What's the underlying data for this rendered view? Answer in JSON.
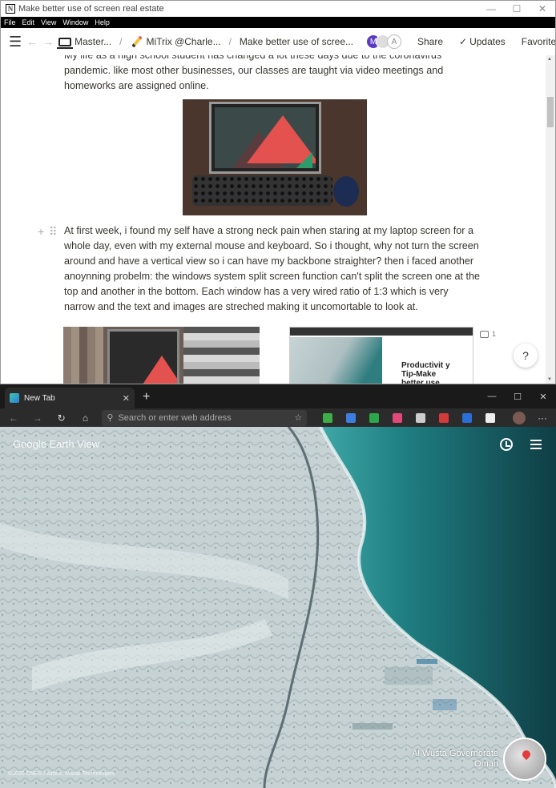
{
  "notion": {
    "window_title": "Make better use of screen real estate",
    "app_icon_letter": "N",
    "menu": [
      "File",
      "Edit",
      "View",
      "Window",
      "Help"
    ],
    "breadcrumbs": [
      "Master...",
      "MiTrix @Charle...",
      "Make better use of scree..."
    ],
    "avatar_initials": [
      "M",
      "A"
    ],
    "actions": {
      "share": "Share",
      "updates": "Updates",
      "favorite": "Favorite",
      "more": "•••"
    },
    "paragraph_1": "My life as a high school student has changed a lot these days due to the coronavirus pandemic. like most other businesses, our classes are taught via video meetings and homeworks are assigned online.",
    "paragraph_2": "At first week, i found my self have a strong neck pain when staring at my laptop screen for a whole day, even with my external mouse and keyboard. So i thought, why not turn the screen around and have a vertical view so i can have my backbone straighter? then i faced another anoynning probelm: the windows system split screen function can't split the screen one at the top and another in the bottom. Each window has a very wired ratio of 1:3 which is very narrow and the text and images are streched making it uncomortable to look at.",
    "embedded_screenshot_heading": "Productivit y Tip-Make better use",
    "comment_count": "1",
    "help_label": "?"
  },
  "edge": {
    "tab_title": "New Tab",
    "new_tab_symbol": "+",
    "address_placeholder": "Search or enter web address",
    "more_label": "···",
    "extension_colors": [
      "#3fae49",
      "#3d7fe0",
      "#2aa84a",
      "#e04a7a",
      "#cccccc",
      "#d33b3b",
      "#2b6fd6",
      "#eeeeee"
    ],
    "earth_view": {
      "logo": "Google Earth View",
      "location_line_1": "Al Wusta Governorate",
      "location_line_2": "Oman",
      "credit": "©2020 CNES / Airbus, Maxar Technologies"
    }
  }
}
